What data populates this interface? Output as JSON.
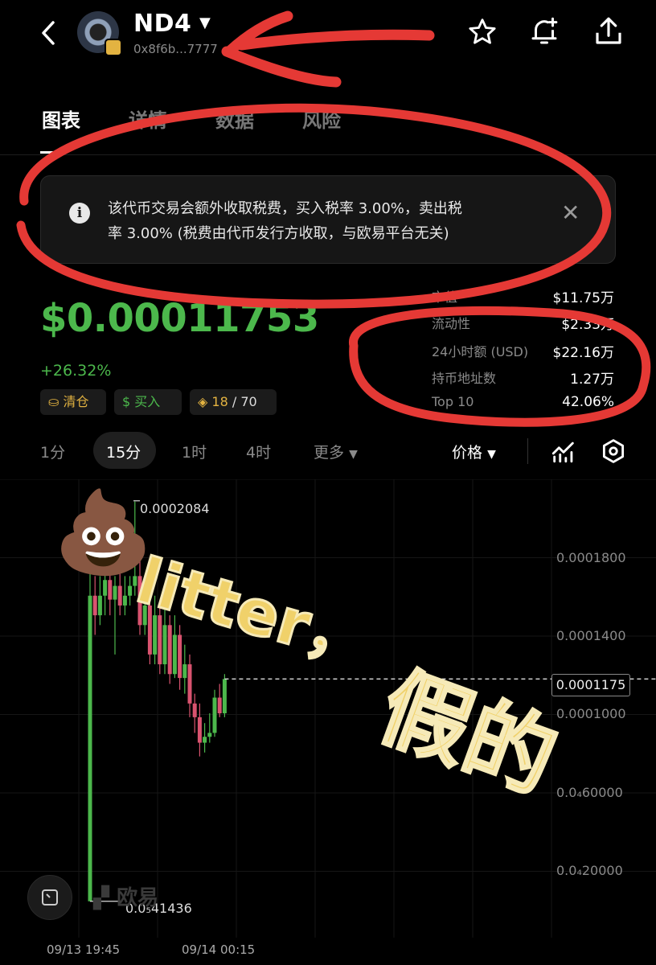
{
  "header": {
    "title": "ND4",
    "address": "0x8f6b...7777"
  },
  "tabs": [
    {
      "label": "图表"
    },
    {
      "label": "详情"
    },
    {
      "label": "数据"
    },
    {
      "label": "风险"
    }
  ],
  "notice": {
    "line1": "该代币交易会额外收取税费，买入税率 3.00%，卖出税",
    "line2": "率 3.00% (税费由代币发行方收取，与欧易平台无关)"
  },
  "price": {
    "value": "$0.00011753",
    "change": "+26.32%"
  },
  "badges": {
    "clear": "清仓",
    "buy": "买入",
    "score": "18",
    "score_total": "/ 70"
  },
  "stats": [
    {
      "label": "市值",
      "value": "$11.75万"
    },
    {
      "label": "流动性",
      "value": "$2.33万"
    },
    {
      "label": "24小时额 (USD)",
      "value": "$22.16万"
    },
    {
      "label": "持币地址数",
      "value": "1.27万"
    },
    {
      "label": "Top 10",
      "value": "42.06%"
    }
  ],
  "timeframes": [
    "1分",
    "15分",
    "1时",
    "4时",
    "更多"
  ],
  "timeframe_active": "15分",
  "chart_mode": "价格",
  "chart_data": {
    "type": "candlestick",
    "high_label": "0.0002084",
    "low_label": "0.0₅41436",
    "current_label": "0.0001175",
    "y_ticks": [
      "0.0001800",
      "0.0001400",
      "0.0001000",
      "0.0₄60000",
      "0.0₄20000"
    ],
    "x_ticks": [
      "09/13 19:45",
      "09/14 00:15"
    ],
    "candles": [
      {
        "o": 4.1e-06,
        "c": 0.00016,
        "h": 0.000175,
        "l": 4.1e-06
      },
      {
        "o": 0.00016,
        "c": 0.00015,
        "h": 0.00017,
        "l": 0.00014
      },
      {
        "o": 0.00015,
        "c": 0.00016,
        "h": 0.00017,
        "l": 0.000145
      },
      {
        "o": 0.00016,
        "c": 0.000168,
        "h": 0.000172,
        "l": 0.00015
      },
      {
        "o": 0.000168,
        "c": 0.000158,
        "h": 0.000172,
        "l": 0.00015
      },
      {
        "o": 0.000158,
        "c": 0.000165,
        "h": 0.00017,
        "l": 0.00013
      },
      {
        "o": 0.000165,
        "c": 0.000155,
        "h": 0.000176,
        "l": 0.00015
      },
      {
        "o": 0.000155,
        "c": 0.00016,
        "h": 0.00017,
        "l": 0.00015
      },
      {
        "o": 0.00016,
        "c": 0.000165,
        "h": 0.00017,
        "l": 0.000155
      },
      {
        "o": 0.000165,
        "c": 0.00017,
        "h": 0.000208,
        "l": 0.00016
      },
      {
        "o": 0.00017,
        "c": 0.000145,
        "h": 0.00018,
        "l": 0.00014
      },
      {
        "o": 0.000145,
        "c": 0.000155,
        "h": 0.000165,
        "l": 0.00014
      },
      {
        "o": 0.000155,
        "c": 0.00013,
        "h": 0.000165,
        "l": 0.000125
      },
      {
        "o": 0.00013,
        "c": 0.00015,
        "h": 0.00016,
        "l": 0.000125
      },
      {
        "o": 0.00015,
        "c": 0.000125,
        "h": 0.000155,
        "l": 0.00012
      },
      {
        "o": 0.000125,
        "c": 0.000145,
        "h": 0.000155,
        "l": 0.00012
      },
      {
        "o": 0.000145,
        "c": 0.00012,
        "h": 0.00015,
        "l": 0.000115
      },
      {
        "o": 0.00012,
        "c": 0.00014,
        "h": 0.00015,
        "l": 0.000118
      },
      {
        "o": 0.00014,
        "c": 0.000118,
        "h": 0.000145,
        "l": 0.000112
      },
      {
        "o": 0.000118,
        "c": 0.000125,
        "h": 0.000135,
        "l": 0.00011
      },
      {
        "o": 0.000125,
        "c": 0.000105,
        "h": 0.00013,
        "l": 9.8e-05
      },
      {
        "o": 0.000105,
        "c": 9.8e-05,
        "h": 0.00011,
        "l": 9e-05
      },
      {
        "o": 9.8e-05,
        "c": 8.5e-05,
        "h": 0.000105,
        "l": 7.8e-05
      },
      {
        "o": 8.5e-05,
        "c": 8.8e-05,
        "h": 9.5e-05,
        "l": 8e-05
      },
      {
        "o": 8.8e-05,
        "c": 9e-05,
        "h": 0.0001,
        "l": 8.5e-05
      },
      {
        "o": 9e-05,
        "c": 0.000108,
        "h": 0.000112,
        "l": 8.8e-05
      },
      {
        "o": 0.000108,
        "c": 0.0001,
        "h": 0.000115,
        "l": 9.8e-05
      },
      {
        "o": 0.0001,
        "c": 0.0001175,
        "h": 0.00012,
        "l": 9.8e-05
      }
    ]
  },
  "watermark": "欧易",
  "annotations": {
    "emoji": "💩",
    "text1": "litter，",
    "text2": "假的"
  },
  "colors": {
    "up": "#4cb84c",
    "down": "#d9536f",
    "marker": "#e53935",
    "highlight": "#f0d16a"
  }
}
